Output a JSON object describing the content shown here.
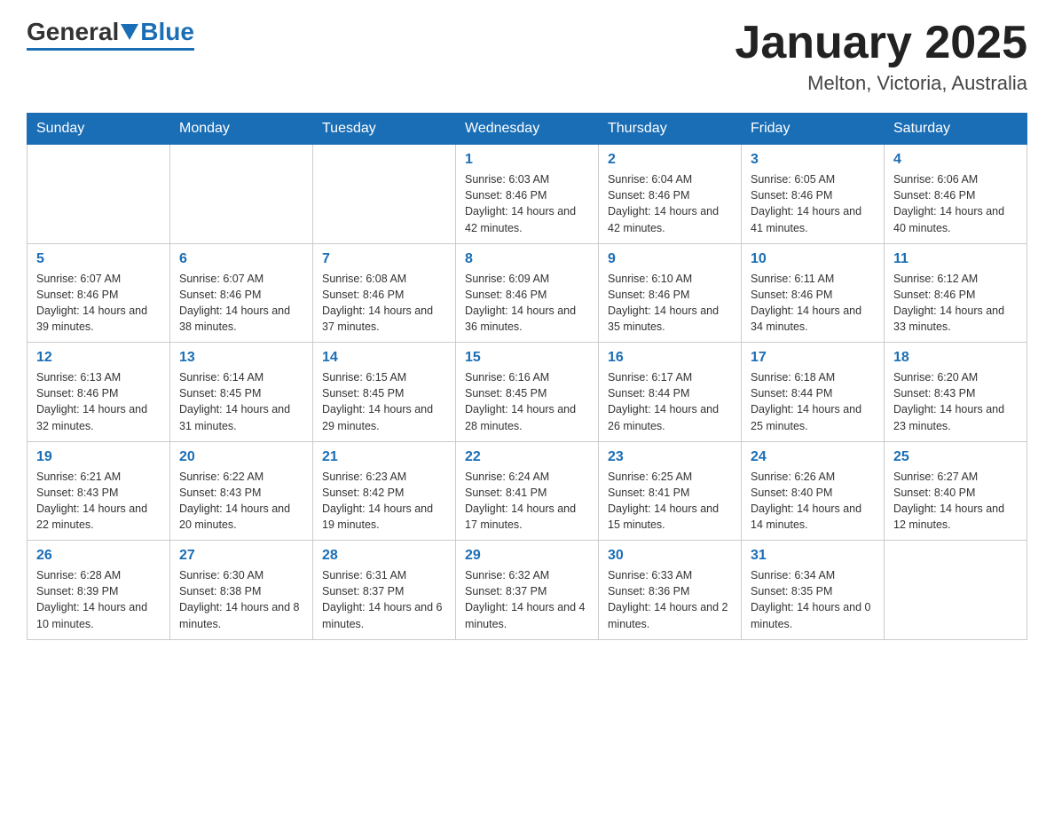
{
  "header": {
    "logo_general": "General",
    "logo_blue": "Blue",
    "month_title": "January 2025",
    "location": "Melton, Victoria, Australia"
  },
  "weekdays": [
    "Sunday",
    "Monday",
    "Tuesday",
    "Wednesday",
    "Thursday",
    "Friday",
    "Saturday"
  ],
  "weeks": [
    [
      {
        "day": "",
        "sunrise": "",
        "sunset": "",
        "daylight": ""
      },
      {
        "day": "",
        "sunrise": "",
        "sunset": "",
        "daylight": ""
      },
      {
        "day": "",
        "sunrise": "",
        "sunset": "",
        "daylight": ""
      },
      {
        "day": "1",
        "sunrise": "Sunrise: 6:03 AM",
        "sunset": "Sunset: 8:46 PM",
        "daylight": "Daylight: 14 hours and 42 minutes."
      },
      {
        "day": "2",
        "sunrise": "Sunrise: 6:04 AM",
        "sunset": "Sunset: 8:46 PM",
        "daylight": "Daylight: 14 hours and 42 minutes."
      },
      {
        "day": "3",
        "sunrise": "Sunrise: 6:05 AM",
        "sunset": "Sunset: 8:46 PM",
        "daylight": "Daylight: 14 hours and 41 minutes."
      },
      {
        "day": "4",
        "sunrise": "Sunrise: 6:06 AM",
        "sunset": "Sunset: 8:46 PM",
        "daylight": "Daylight: 14 hours and 40 minutes."
      }
    ],
    [
      {
        "day": "5",
        "sunrise": "Sunrise: 6:07 AM",
        "sunset": "Sunset: 8:46 PM",
        "daylight": "Daylight: 14 hours and 39 minutes."
      },
      {
        "day": "6",
        "sunrise": "Sunrise: 6:07 AM",
        "sunset": "Sunset: 8:46 PM",
        "daylight": "Daylight: 14 hours and 38 minutes."
      },
      {
        "day": "7",
        "sunrise": "Sunrise: 6:08 AM",
        "sunset": "Sunset: 8:46 PM",
        "daylight": "Daylight: 14 hours and 37 minutes."
      },
      {
        "day": "8",
        "sunrise": "Sunrise: 6:09 AM",
        "sunset": "Sunset: 8:46 PM",
        "daylight": "Daylight: 14 hours and 36 minutes."
      },
      {
        "day": "9",
        "sunrise": "Sunrise: 6:10 AM",
        "sunset": "Sunset: 8:46 PM",
        "daylight": "Daylight: 14 hours and 35 minutes."
      },
      {
        "day": "10",
        "sunrise": "Sunrise: 6:11 AM",
        "sunset": "Sunset: 8:46 PM",
        "daylight": "Daylight: 14 hours and 34 minutes."
      },
      {
        "day": "11",
        "sunrise": "Sunrise: 6:12 AM",
        "sunset": "Sunset: 8:46 PM",
        "daylight": "Daylight: 14 hours and 33 minutes."
      }
    ],
    [
      {
        "day": "12",
        "sunrise": "Sunrise: 6:13 AM",
        "sunset": "Sunset: 8:46 PM",
        "daylight": "Daylight: 14 hours and 32 minutes."
      },
      {
        "day": "13",
        "sunrise": "Sunrise: 6:14 AM",
        "sunset": "Sunset: 8:45 PM",
        "daylight": "Daylight: 14 hours and 31 minutes."
      },
      {
        "day": "14",
        "sunrise": "Sunrise: 6:15 AM",
        "sunset": "Sunset: 8:45 PM",
        "daylight": "Daylight: 14 hours and 29 minutes."
      },
      {
        "day": "15",
        "sunrise": "Sunrise: 6:16 AM",
        "sunset": "Sunset: 8:45 PM",
        "daylight": "Daylight: 14 hours and 28 minutes."
      },
      {
        "day": "16",
        "sunrise": "Sunrise: 6:17 AM",
        "sunset": "Sunset: 8:44 PM",
        "daylight": "Daylight: 14 hours and 26 minutes."
      },
      {
        "day": "17",
        "sunrise": "Sunrise: 6:18 AM",
        "sunset": "Sunset: 8:44 PM",
        "daylight": "Daylight: 14 hours and 25 minutes."
      },
      {
        "day": "18",
        "sunrise": "Sunrise: 6:20 AM",
        "sunset": "Sunset: 8:43 PM",
        "daylight": "Daylight: 14 hours and 23 minutes."
      }
    ],
    [
      {
        "day": "19",
        "sunrise": "Sunrise: 6:21 AM",
        "sunset": "Sunset: 8:43 PM",
        "daylight": "Daylight: 14 hours and 22 minutes."
      },
      {
        "day": "20",
        "sunrise": "Sunrise: 6:22 AM",
        "sunset": "Sunset: 8:43 PM",
        "daylight": "Daylight: 14 hours and 20 minutes."
      },
      {
        "day": "21",
        "sunrise": "Sunrise: 6:23 AM",
        "sunset": "Sunset: 8:42 PM",
        "daylight": "Daylight: 14 hours and 19 minutes."
      },
      {
        "day": "22",
        "sunrise": "Sunrise: 6:24 AM",
        "sunset": "Sunset: 8:41 PM",
        "daylight": "Daylight: 14 hours and 17 minutes."
      },
      {
        "day": "23",
        "sunrise": "Sunrise: 6:25 AM",
        "sunset": "Sunset: 8:41 PM",
        "daylight": "Daylight: 14 hours and 15 minutes."
      },
      {
        "day": "24",
        "sunrise": "Sunrise: 6:26 AM",
        "sunset": "Sunset: 8:40 PM",
        "daylight": "Daylight: 14 hours and 14 minutes."
      },
      {
        "day": "25",
        "sunrise": "Sunrise: 6:27 AM",
        "sunset": "Sunset: 8:40 PM",
        "daylight": "Daylight: 14 hours and 12 minutes."
      }
    ],
    [
      {
        "day": "26",
        "sunrise": "Sunrise: 6:28 AM",
        "sunset": "Sunset: 8:39 PM",
        "daylight": "Daylight: 14 hours and 10 minutes."
      },
      {
        "day": "27",
        "sunrise": "Sunrise: 6:30 AM",
        "sunset": "Sunset: 8:38 PM",
        "daylight": "Daylight: 14 hours and 8 minutes."
      },
      {
        "day": "28",
        "sunrise": "Sunrise: 6:31 AM",
        "sunset": "Sunset: 8:37 PM",
        "daylight": "Daylight: 14 hours and 6 minutes."
      },
      {
        "day": "29",
        "sunrise": "Sunrise: 6:32 AM",
        "sunset": "Sunset: 8:37 PM",
        "daylight": "Daylight: 14 hours and 4 minutes."
      },
      {
        "day": "30",
        "sunrise": "Sunrise: 6:33 AM",
        "sunset": "Sunset: 8:36 PM",
        "daylight": "Daylight: 14 hours and 2 minutes."
      },
      {
        "day": "31",
        "sunrise": "Sunrise: 6:34 AM",
        "sunset": "Sunset: 8:35 PM",
        "daylight": "Daylight: 14 hours and 0 minutes."
      },
      {
        "day": "",
        "sunrise": "",
        "sunset": "",
        "daylight": ""
      }
    ]
  ]
}
